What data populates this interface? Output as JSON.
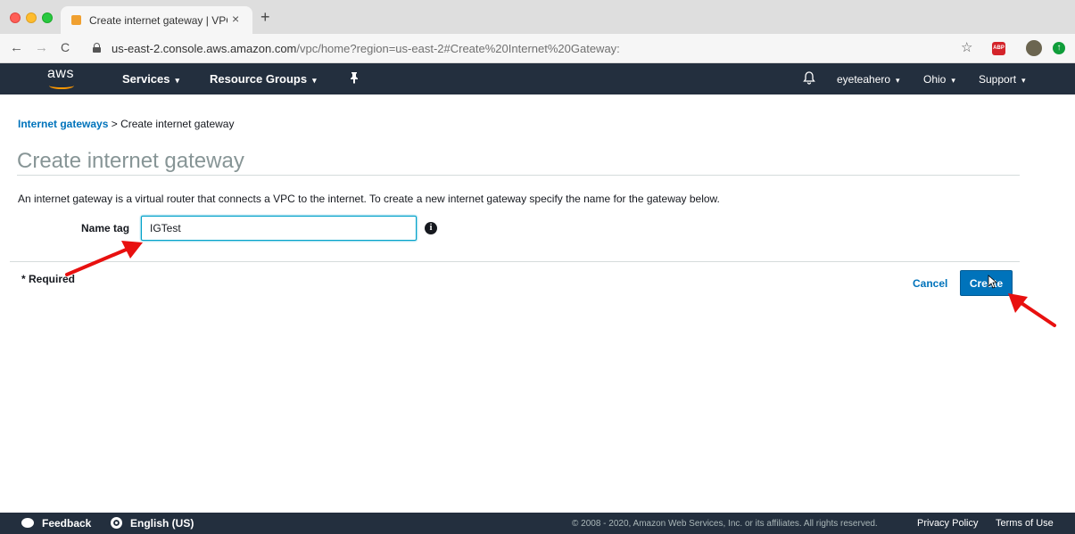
{
  "browser": {
    "tab_title": "Create internet gateway | VPC",
    "tab_close": "×",
    "new_tab": "+",
    "back": "←",
    "forward": "→",
    "reload": "C",
    "url_host": "us-east-2.console.aws.amazon.com",
    "url_path": "/vpc/home?region=us-east-2#Create%20Internet%20Gateway:",
    "star": "☆",
    "abp_label": "ABP",
    "ext_green": "↑"
  },
  "aws_nav": {
    "logo_text": "aws",
    "services": "Services",
    "resource_groups": "Resource Groups",
    "pin": "✦",
    "bell": "♫",
    "user": "eyeteahero",
    "region": "Ohio",
    "support": "Support",
    "caret": "▾",
    "bell_icon": "🔔"
  },
  "breadcrumb": {
    "link": "Internet gateways",
    "separator": " > ",
    "current": "Create internet gateway"
  },
  "page": {
    "title": "Create internet gateway",
    "description": "An internet gateway is a virtual router that connects a VPC to the internet. To create a new internet gateway specify the name for the gateway below.",
    "name_label": "Name tag",
    "name_value": "IGTest",
    "info": "i",
    "required": "* Required",
    "cancel": "Cancel",
    "create": "Create"
  },
  "footer": {
    "feedback": "Feedback",
    "language": "English (US)",
    "copyright": "© 2008 - 2020, Amazon Web Services, Inc. or its affiliates. All rights reserved.",
    "privacy": "Privacy Policy",
    "terms": "Terms of Use"
  },
  "colors": {
    "aws_nav_bg": "#232f3e",
    "link_blue": "#0073bb",
    "primary_button": "#0073bb",
    "annotation_arrow": "#e8100f",
    "aws_orange": "#ff9900"
  }
}
